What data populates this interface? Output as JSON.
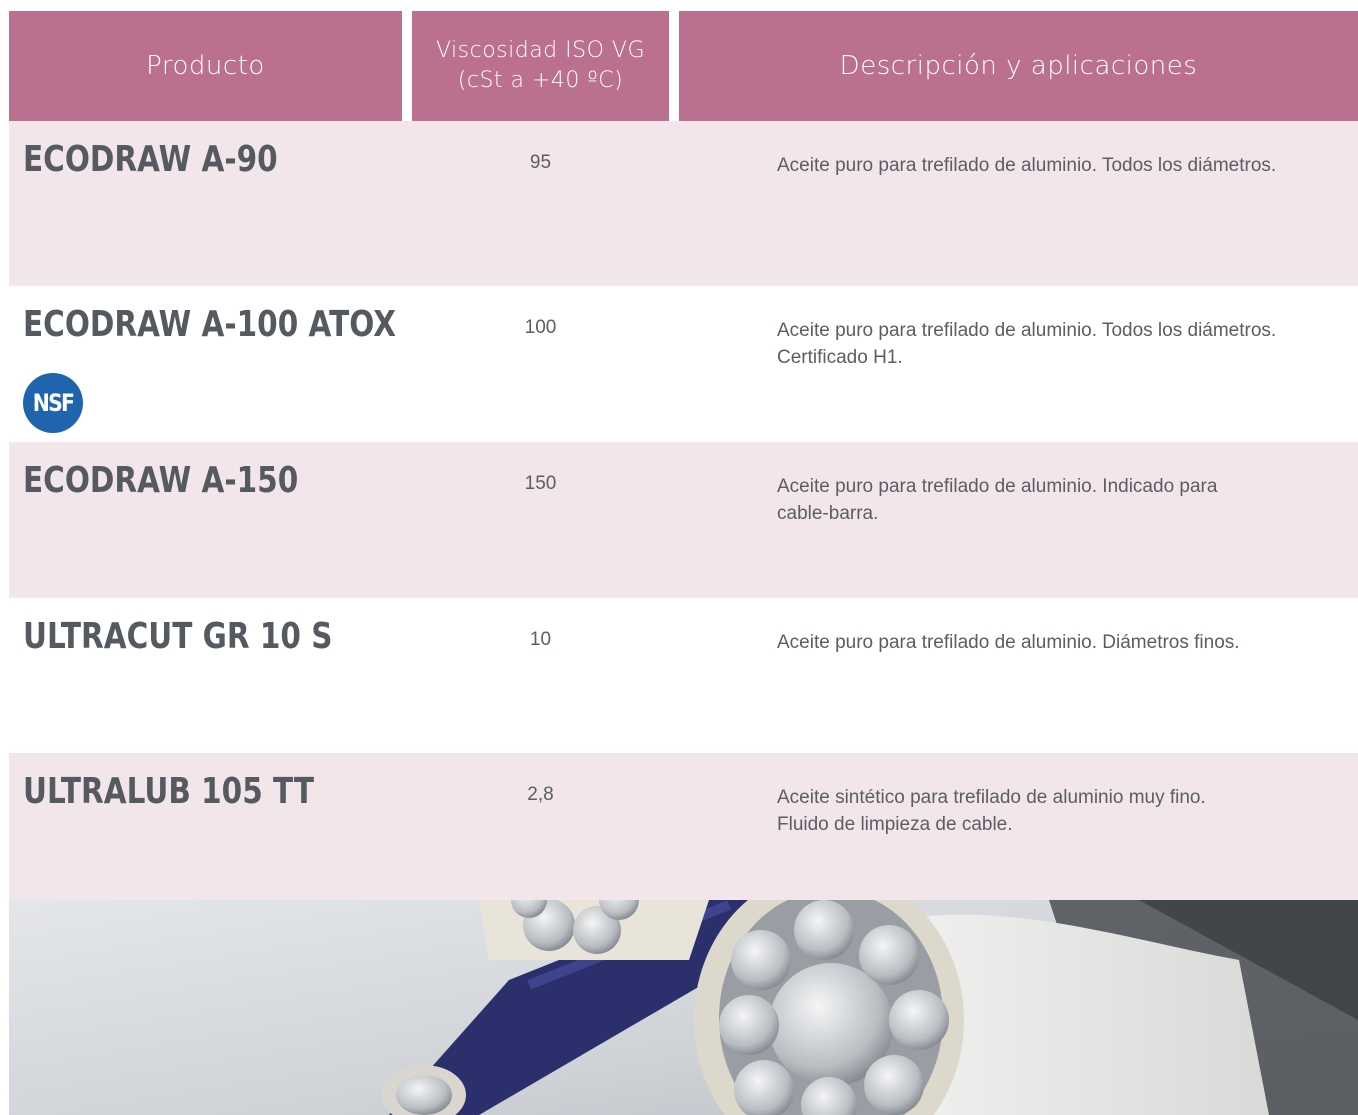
{
  "header": {
    "col_product": "Producto",
    "col_viscosity_line1": "Viscosidad ISO VG",
    "col_viscosity_line2": "(cSt a +40 ºC)",
    "col_description": "Descripción y aplicaciones"
  },
  "rows": [
    {
      "product": "ECODRAW A-90",
      "viscosity": "95",
      "description": [
        "Aceite puro para trefilado de aluminio. Todos los diámetros."
      ]
    },
    {
      "product": "ECODRAW A-100 ATOX",
      "viscosity": "100",
      "description": [
        "Aceite puro para trefilado de aluminio. Todos los diámetros.",
        "Certificado H1."
      ],
      "badge": "NSF"
    },
    {
      "product": "ECODRAW A-150",
      "viscosity": "150",
      "description": [
        "Aceite puro para trefilado de aluminio. Indicado para",
        "cable-barra."
      ]
    },
    {
      "product": "ULTRACUT GR 10 S",
      "viscosity": "10",
      "description": [
        "Aceite puro para trefilado de aluminio. Diámetros finos."
      ]
    },
    {
      "product": "ULTRALUB 105 TT",
      "viscosity": "2,8",
      "description": [
        "Aceite sintético para trefilado de aluminio muy fino.",
        "Fluido de limpieza de cable."
      ]
    }
  ],
  "colors": {
    "header_bg": "#bc7090",
    "row_shade": "#f3e6ea",
    "text": "#5a5e63",
    "nsf_blue": "#2064ae"
  }
}
